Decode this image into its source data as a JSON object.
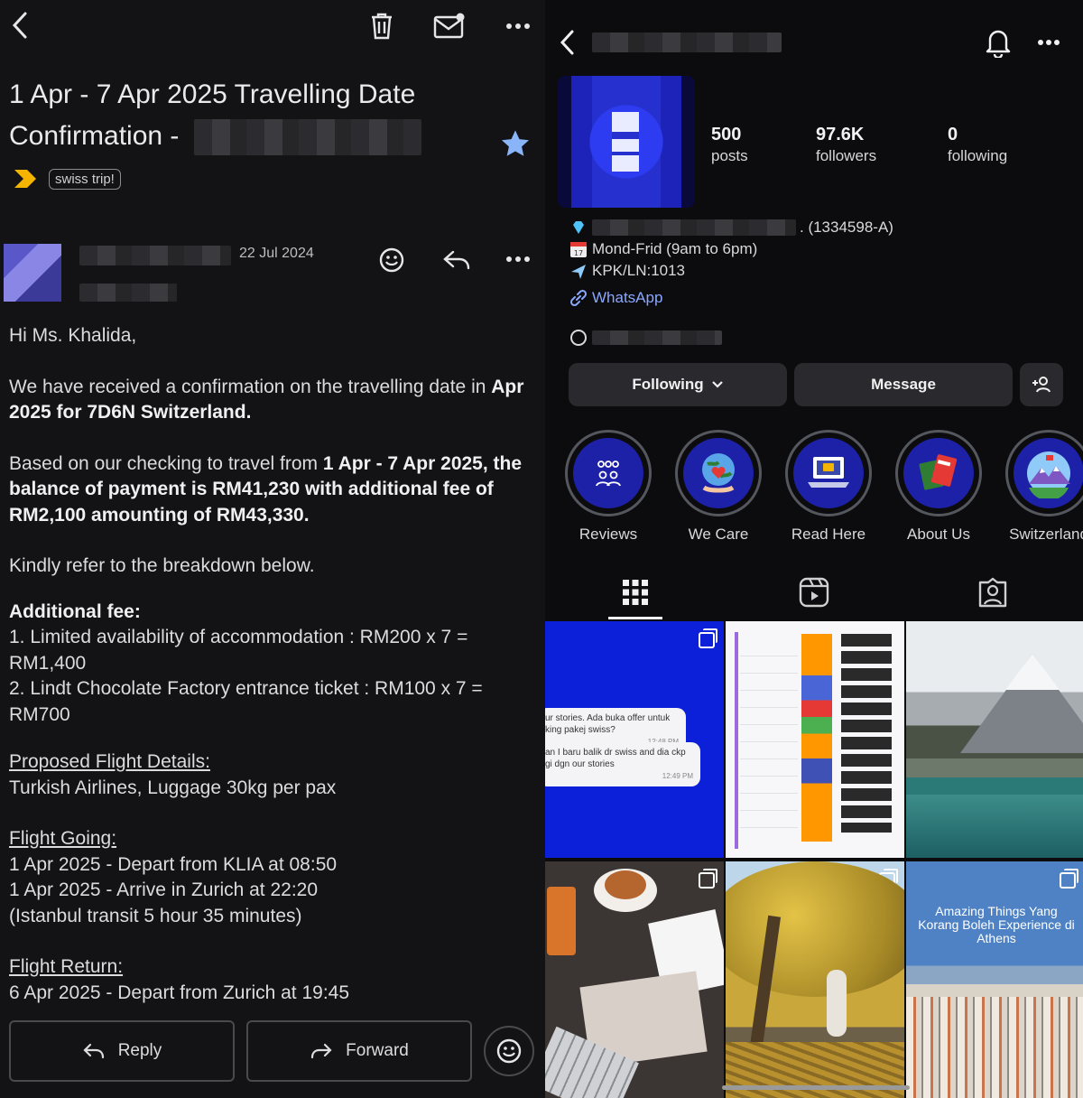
{
  "email": {
    "subject_line1": "1 Apr - 7 Apr 2025 Travelling Date",
    "subject_line2": "Confirmation -",
    "label_chip": "swiss trip!",
    "date": "22 Jul 2024",
    "greeting": "Hi Ms. Khalida,",
    "para1_text": "We have received a confirmation on the travelling date in ",
    "para1_bold": "Apr 2025 for 7D6N Switzerland.",
    "para2_text": "Based on our checking to travel from ",
    "para2_bold": "1 Apr - 7 Apr 2025, the balance of payment is RM41,230 with additional fee of RM2,100 amounting of RM43,330.",
    "para3": "Kindly refer to the breakdown below.",
    "additional_fee_heading": "Additional fee:",
    "fee_item1": "1. Limited availability of accommodation : RM200 x 7 = RM1,400",
    "fee_item2": "2. Lindt Chocolate Factory entrance ticket : RM100 x 7 = RM700",
    "flight_details_heading": "Proposed Flight Details:",
    "flight_details_text": "Turkish Airlines, Luggage 30kg per pax",
    "flight_going_heading": "Flight Going:",
    "flight_going_1": "1 Apr 2025 - Depart from KLIA at 08:50",
    "flight_going_2": "1 Apr 2025 - Arrive in Zurich at 22:20",
    "flight_going_3": "(Istanbul transit 5 hour 35 minutes)",
    "flight_return_heading": "Flight Return:",
    "flight_return_1": "6 Apr 2025 - Depart from Zurich at 19:45",
    "reply_label": "Reply",
    "forward_label": "Forward"
  },
  "instagram": {
    "stats": [
      {
        "num": "500",
        "label": "posts"
      },
      {
        "num": "97.6K",
        "label": "followers"
      },
      {
        "num": "0",
        "label": "following"
      }
    ],
    "bio_company_suffix": ". (1334598-A)",
    "bio_hours": "Mond-Frid (9am to 6pm)",
    "bio_license": "KPK/LN:1013",
    "bio_link": "WhatsApp",
    "following_label": "Following",
    "message_label": "Message",
    "highlights": [
      {
        "name": "Reviews",
        "icon": "people-icon"
      },
      {
        "name": "We Care",
        "icon": "heart-globe-icon"
      },
      {
        "name": "Read Here",
        "icon": "laptop-icon"
      },
      {
        "name": "About Us",
        "icon": "passport-icon"
      },
      {
        "name": "Switzerland",
        "icon": "mountain-icon"
      }
    ],
    "post1_bubble1": "ur stories. Ada buka offer untuk king pakej swiss?",
    "post1_bubble1_time": "12:48 PM",
    "post1_bubble2": "an I baru balik dr swiss and dia ckp gi dgn our stories",
    "post1_bubble2_time": "12:49 PM",
    "post6_title": "Amazing Things Yang Korang Boleh Experience di Athens",
    "colors": {
      "accent_blue": "#0c1fd9",
      "link": "#8aa7ff",
      "star": "#8ab4f8"
    }
  }
}
